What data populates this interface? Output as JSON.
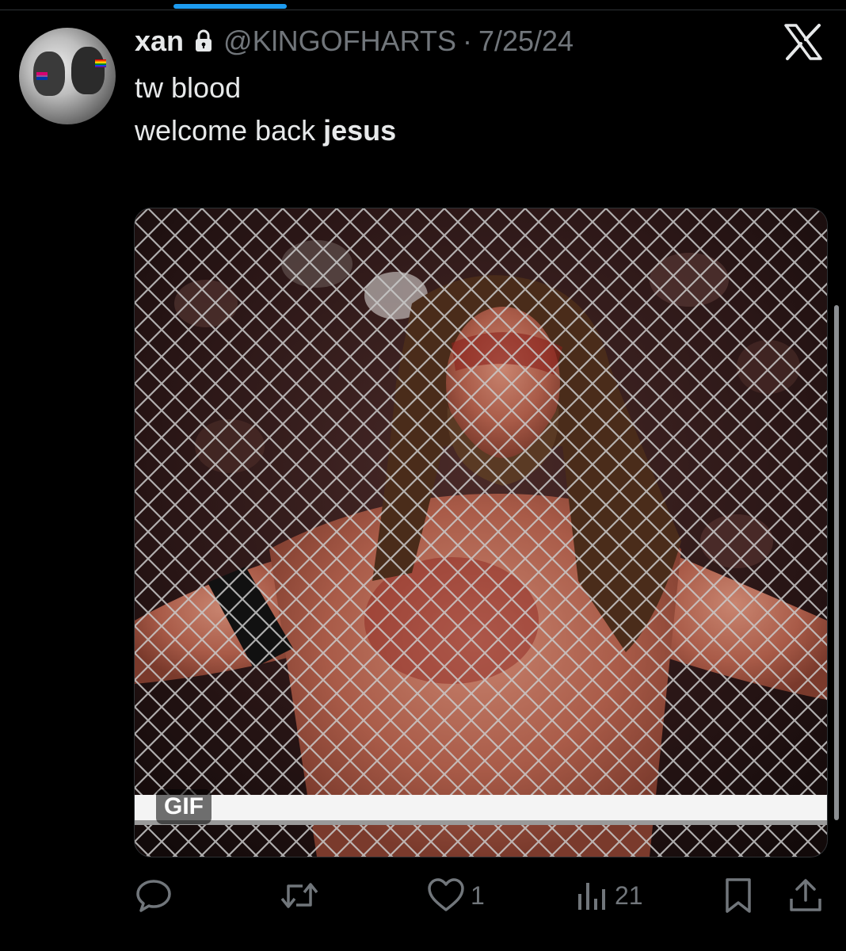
{
  "tweet": {
    "display_name": "xan",
    "handle": "@KlNGOFHARTS",
    "separator": "·",
    "date": "7/25/24",
    "text_line1": "tw blood",
    "text_line2_prefix": "welcome back ",
    "text_line2_bold": "jesus",
    "media_badge": "GIF"
  },
  "actions": {
    "reply_count": "",
    "repost_count": "",
    "like_count": "1",
    "views_count": "21"
  },
  "icons": {
    "lock": "lock-icon",
    "close": "x-logo-icon",
    "reply": "reply-icon",
    "repost": "repost-icon",
    "like": "heart-icon",
    "views": "views-icon",
    "bookmark": "bookmark-icon",
    "share": "share-icon"
  },
  "colors": {
    "background": "#000000",
    "text_primary": "#e7e9ea",
    "text_secondary": "#71767b",
    "accent": "#1d9bf0"
  }
}
